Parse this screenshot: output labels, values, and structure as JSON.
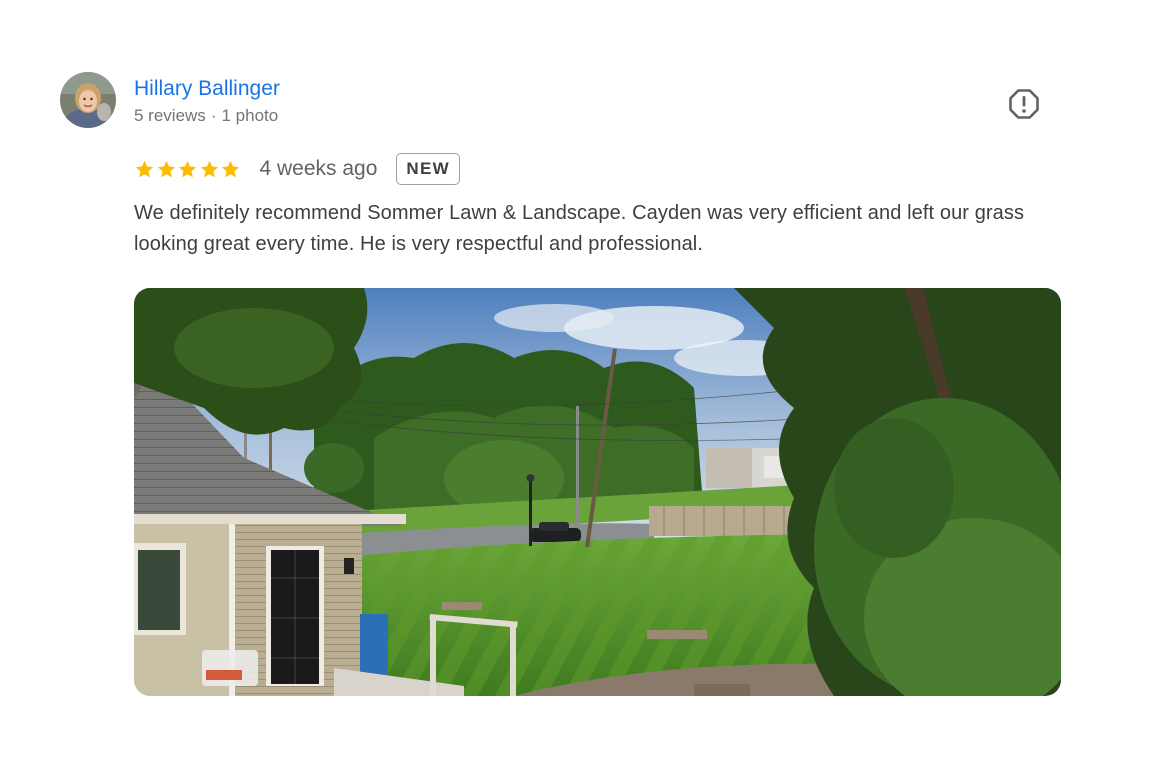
{
  "reviewer": {
    "name": "Hillary Ballinger",
    "reviews_count": "5 reviews",
    "separator": "·",
    "photos_count": "1 photo",
    "avatar_icon": "profile-photo"
  },
  "review": {
    "rating": 5,
    "max_rating": 5,
    "star_color": "#fbbc04",
    "date": "4 weeks ago",
    "badge": "NEW",
    "text": "We definitely recommend Sommer Lawn & Landscape. Cayden was very efficient and left our grass looking great every time. He is very respectful and professional."
  },
  "actions": {
    "report_icon": "report-flag-icon"
  },
  "colors": {
    "name_link": "#1a73e8",
    "meta_text": "#70757a",
    "body_text": "#3c4043"
  }
}
